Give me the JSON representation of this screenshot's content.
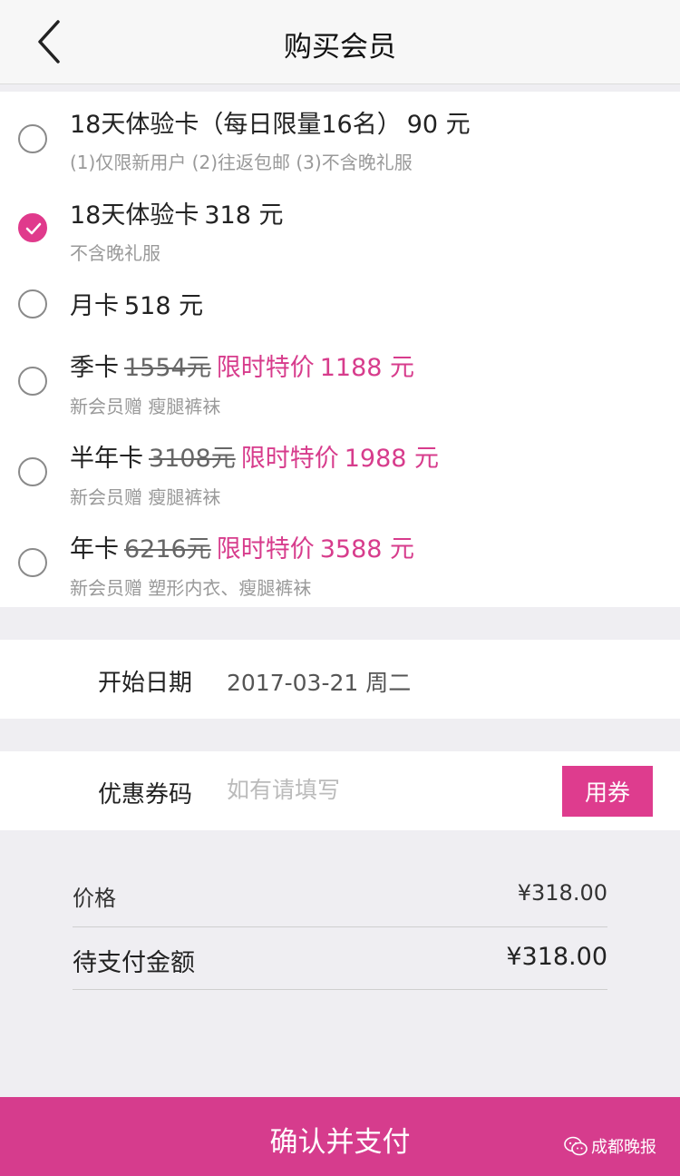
{
  "header": {
    "title": "购买会员"
  },
  "plans": [
    {
      "selected": false,
      "name": "18天体验卡（每日限量16名）",
      "original_price": "",
      "promo_label": "",
      "price": "90 元",
      "note": "(1)仅限新用户 (2)往返包邮 (3)不含晚礼服"
    },
    {
      "selected": true,
      "name": "18天体验卡",
      "original_price": "",
      "promo_label": "",
      "price": "318 元",
      "note": "不含晚礼服"
    },
    {
      "selected": false,
      "name": "月卡",
      "original_price": "",
      "promo_label": "",
      "price": "518 元",
      "note": ""
    },
    {
      "selected": false,
      "name": "季卡",
      "original_price": "1554元",
      "promo_label": "限时特价",
      "price": "1188 元",
      "note": "新会员赠 瘦腿裤袜"
    },
    {
      "selected": false,
      "name": "半年卡",
      "original_price": "3108元",
      "promo_label": "限时特价",
      "price": "1988 元",
      "note": "新会员赠 瘦腿裤袜"
    },
    {
      "selected": false,
      "name": "年卡",
      "original_price": "6216元",
      "promo_label": "限时特价",
      "price": "3588 元",
      "note": "新会员赠 塑形内衣、瘦腿裤袜"
    }
  ],
  "start_date": {
    "label": "开始日期",
    "value": "2017-03-21 周二"
  },
  "coupon": {
    "label": "优惠券码",
    "placeholder": "如有请填写",
    "value": "",
    "button": "用券"
  },
  "summary": {
    "price_label": "价格",
    "price_value": "¥318.00",
    "due_label": "待支付金额",
    "due_value": "¥318.00"
  },
  "footer": {
    "pay_button": "确认并支付",
    "watermark": "成都晚报"
  },
  "colors": {
    "accent": "#d63c8d",
    "promo_text": "#d73c8c",
    "background": "#efeef2"
  }
}
